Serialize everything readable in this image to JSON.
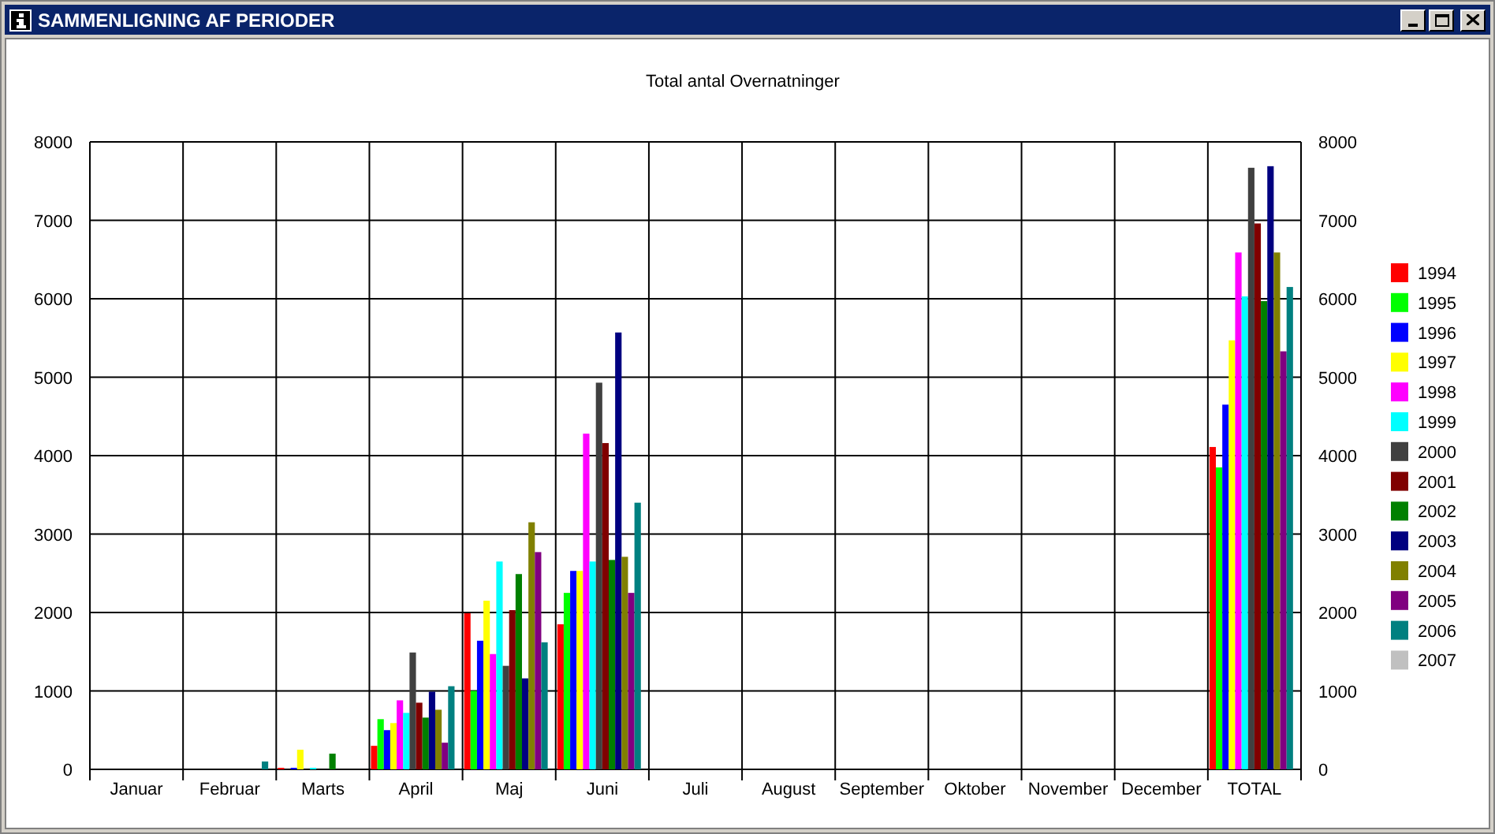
{
  "window": {
    "title": "SAMMENLIGNING AF PERIODER"
  },
  "chart_data": {
    "type": "bar",
    "title": "Total antal Overnatninger",
    "categories": [
      "Januar",
      "Februar",
      "Marts",
      "April",
      "Maj",
      "Juni",
      "Juli",
      "August",
      "September",
      "Oktober",
      "November",
      "December",
      "TOTAL"
    ],
    "ylim": [
      0,
      8000
    ],
    "yticks": [
      0,
      1000,
      2000,
      3000,
      4000,
      5000,
      6000,
      7000,
      8000
    ],
    "y2ticks": [
      0,
      1000,
      2000,
      3000,
      4000,
      5000,
      6000,
      7000,
      8000
    ],
    "y2lim": [
      0,
      8000
    ],
    "grid": true,
    "legend": true,
    "series": [
      {
        "name": "1994",
        "color": "#ff0000",
        "values": [
          0,
          0,
          20,
          300,
          1990,
          1850,
          0,
          0,
          0,
          0,
          0,
          0,
          4110
        ]
      },
      {
        "name": "1995",
        "color": "#00ff00",
        "values": [
          0,
          0,
          0,
          640,
          1000,
          2250,
          0,
          0,
          0,
          0,
          0,
          0,
          3850
        ]
      },
      {
        "name": "1996",
        "color": "#0000ff",
        "values": [
          0,
          0,
          20,
          500,
          1640,
          2530,
          0,
          0,
          0,
          0,
          0,
          0,
          4650
        ]
      },
      {
        "name": "1997",
        "color": "#ffff00",
        "values": [
          0,
          0,
          250,
          590,
          2150,
          2530,
          0,
          0,
          0,
          0,
          0,
          0,
          5470
        ]
      },
      {
        "name": "1998",
        "color": "#ff00ff",
        "values": [
          0,
          0,
          0,
          880,
          1470,
          4280,
          0,
          0,
          0,
          0,
          0,
          0,
          6590
        ]
      },
      {
        "name": "1999",
        "color": "#00ffff",
        "values": [
          0,
          0,
          20,
          720,
          2650,
          2650,
          0,
          0,
          0,
          0,
          0,
          0,
          6030
        ]
      },
      {
        "name": "2000",
        "color": "#404040",
        "values": [
          0,
          0,
          0,
          1490,
          1320,
          4930,
          0,
          0,
          0,
          0,
          0,
          0,
          7670
        ]
      },
      {
        "name": "2001",
        "color": "#800000",
        "values": [
          0,
          0,
          0,
          850,
          2030,
          4160,
          0,
          0,
          0,
          0,
          0,
          0,
          6960
        ]
      },
      {
        "name": "2002",
        "color": "#008000",
        "values": [
          0,
          0,
          200,
          660,
          2490,
          2670,
          0,
          0,
          0,
          0,
          0,
          0,
          5970
        ]
      },
      {
        "name": "2003",
        "color": "#000080",
        "values": [
          0,
          0,
          0,
          990,
          1160,
          5570,
          0,
          0,
          0,
          0,
          0,
          0,
          7690
        ]
      },
      {
        "name": "2004",
        "color": "#808000",
        "values": [
          0,
          0,
          0,
          760,
          3150,
          2710,
          0,
          0,
          0,
          0,
          0,
          0,
          6590
        ]
      },
      {
        "name": "2005",
        "color": "#800080",
        "values": [
          0,
          0,
          0,
          340,
          2770,
          2250,
          0,
          0,
          0,
          0,
          0,
          0,
          5330
        ]
      },
      {
        "name": "2006",
        "color": "#008080",
        "values": [
          0,
          100,
          0,
          1060,
          1620,
          3400,
          0,
          0,
          0,
          0,
          0,
          0,
          6150
        ]
      },
      {
        "name": "2007",
        "color": "#c0c0c0",
        "values": [
          0,
          0,
          0,
          0,
          0,
          0,
          0,
          0,
          0,
          0,
          0,
          0,
          0
        ]
      }
    ]
  }
}
